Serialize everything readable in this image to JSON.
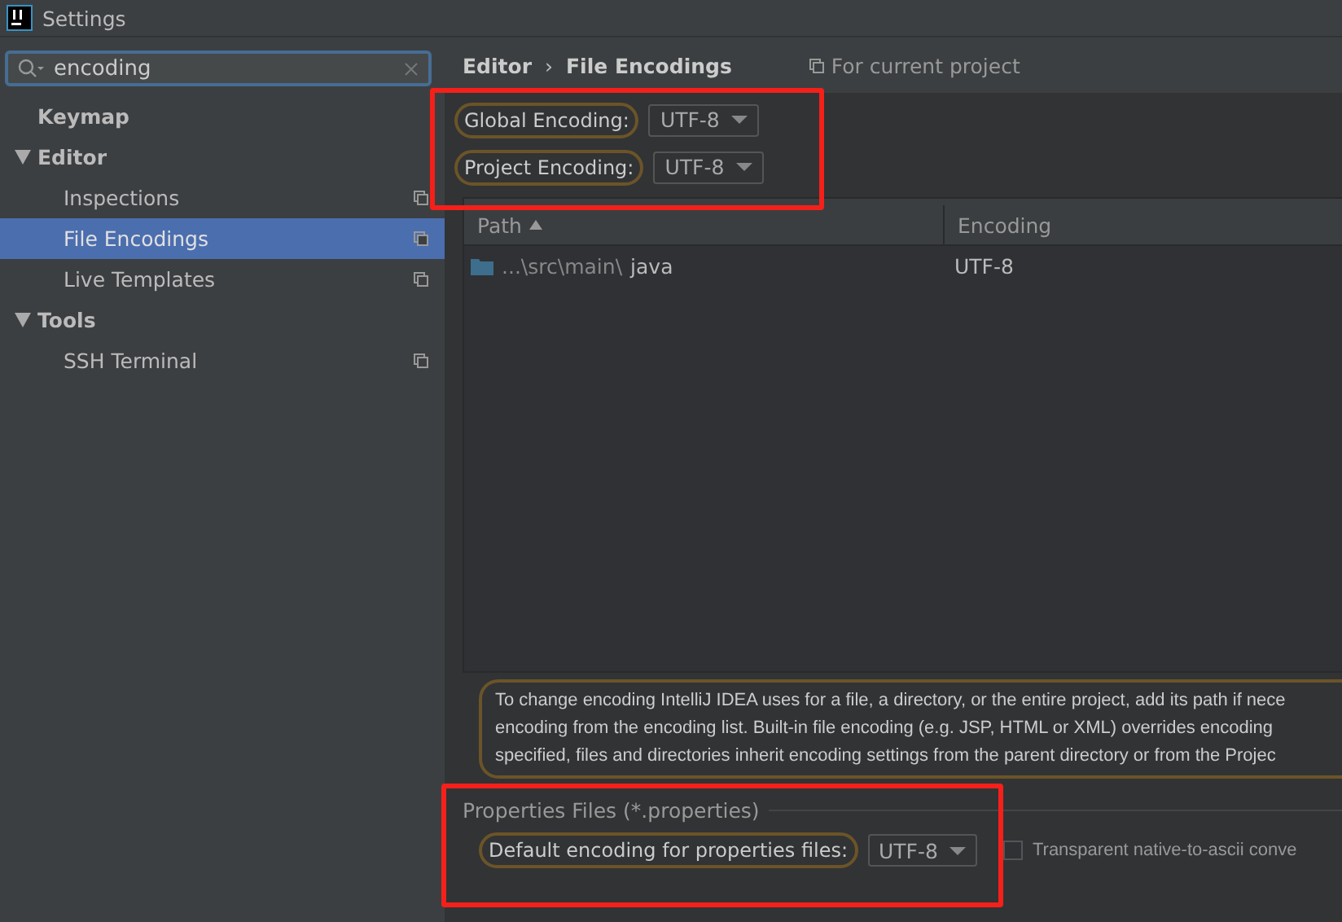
{
  "window": {
    "title": "Settings"
  },
  "search": {
    "value": "encoding"
  },
  "sidebar": {
    "items": [
      {
        "label": "Keymap",
        "selected": false
      },
      {
        "label": "Editor",
        "selected": false,
        "expanded": true,
        "children": [
          {
            "label": "Inspections",
            "selected": false
          },
          {
            "label": "File Encodings",
            "selected": true
          },
          {
            "label": "Live Templates",
            "selected": false
          }
        ]
      },
      {
        "label": "Tools",
        "selected": false,
        "expanded": true,
        "children": [
          {
            "label": "SSH Terminal",
            "selected": false
          }
        ]
      }
    ]
  },
  "breadcrumb": [
    "Editor",
    "›",
    "File Encodings"
  ],
  "scope_note": "For current project",
  "encodings": [
    {
      "label": "Global Encoding:",
      "value": "UTF-8"
    },
    {
      "label": "Project Encoding:",
      "value": "UTF-8"
    }
  ],
  "table": {
    "columns": [
      "Path",
      "Encoding"
    ],
    "rows": [
      {
        "path_prefix": "...\\src\\main\\",
        "path_name": "java",
        "encoding": "UTF-8"
      }
    ]
  },
  "description": [
    "To change encoding IntelliJ IDEA uses for a file, a directory, or the entire project, add its path if nece",
    "encoding from the encoding list. Built-in file encoding (e.g. JSP, HTML or XML) overrides encoding",
    "specified, files and directories inherit encoding settings from the parent directory or from the Projec"
  ],
  "properties": {
    "title": "Properties Files (*.properties)",
    "label": "Default encoding for properties files:",
    "value": "UTF-8",
    "transparent_label": "Transparent native-to-ascii conve",
    "transparent_checked": false
  }
}
